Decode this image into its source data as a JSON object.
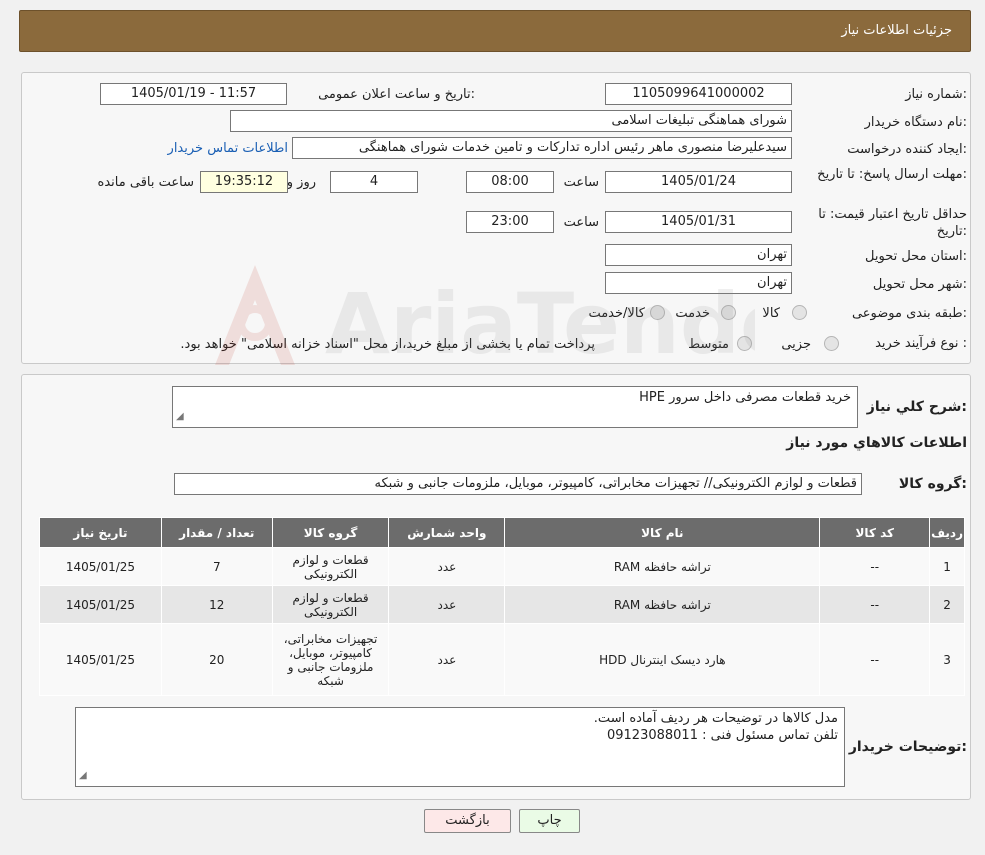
{
  "header": {
    "title": "جزئیات اطلاعات نیاز"
  },
  "form": {
    "need_number_label": "شماره نیاز:",
    "need_number": "1105099641000002",
    "announce_label": "تاریخ و ساعت اعلان عمومی:",
    "announce_value": "1405/01/19 - 11:57",
    "buyer_org_label": "نام دستگاه خریدار:",
    "buyer_org": "شورای هماهنگی تبلیغات اسلامی",
    "creator_label": "ایجاد کننده درخواست:",
    "creator": "سیدعلیرضا منصوری ماهر رئیس اداره تدارکات و تامین خدمات  شورای هماهنگی",
    "contact_link": "اطلاعات تماس خریدار",
    "reply_deadline_label": "مهلت ارسال پاسخ: تا تاریخ:",
    "reply_date": "1405/01/24",
    "time_label": "ساعت",
    "reply_time": "08:00",
    "days_value": "4",
    "days_label": "روز و",
    "remaining_time": "19:35:12",
    "remaining_label": "ساعت باقی مانده",
    "price_validity_label": "حداقل تاریخ اعتبار قیمت: تا تاریخ:",
    "validity_date": "1405/01/31",
    "validity_time": "23:00",
    "province_label": "استان محل تحویل:",
    "province": "تهران",
    "city_label": "شهر محل تحویل:",
    "city": "تهران",
    "category_label": "طبقه بندی موضوعی:",
    "category_options": [
      "کالا",
      "خدمت",
      "کالا/خدمت"
    ],
    "process_label": "نوع فرآیند خرید :",
    "process_options": [
      "جزیی",
      "متوسط"
    ],
    "process_note": "پرداخت تمام یا بخشی از مبلغ خرید،از محل \"اسناد خزانه اسلامی\" خواهد بود."
  },
  "details": {
    "summary_label": "شرح کلي نياز:",
    "summary": "خرید قطعات مصرفی داخل سرور HPE",
    "items_title": "اطلاعات کالاهاي مورد نياز",
    "group_label": "گروه کالا:",
    "group": "قطعات و لوازم الکترونیکی// تجهیزات مخابراتی، کامپیوتر، موبایل، ملزومات جانبی و شبکه",
    "table": {
      "headers": [
        "ردیف",
        "کد کالا",
        "نام کالا",
        "واحد شمارش",
        "گروه کالا",
        "تعداد / مقدار",
        "تاریخ نیاز"
      ],
      "rows": [
        [
          "1",
          "--",
          "تراشه حافظه RAM",
          "عدد",
          "قطعات و لوازم الکترونیکی",
          "7",
          "1405/01/25"
        ],
        [
          "2",
          "--",
          "تراشه حافظه RAM",
          "عدد",
          "قطعات و لوازم الکترونیکی",
          "12",
          "1405/01/25"
        ],
        [
          "3",
          "--",
          "هارد دیسک اینترنال HDD",
          "عدد",
          "تجهیزات مخابراتی، کامپیوتر، موبایل، ملزومات جانبی و شبکه",
          "20",
          "1405/01/25"
        ]
      ]
    },
    "buyer_notes_label": "توضیحات خریدار:",
    "buyer_notes_line1": "مدل کالاها در توضیحات هر ردیف آماده است.",
    "buyer_notes_line2": "تلفن تماس مسئول فنی : 09123088011"
  },
  "buttons": {
    "print": "چاپ",
    "back": "بازگشت"
  },
  "watermark_text": "AriaTender.neT",
  "colors": {
    "header_bg": "#8b6a3c",
    "table_header_bg": "#6c6c6c",
    "link": "#1a5fb4",
    "back_button_bg": "#fde8e8",
    "print_button_bg": "#eafbe6"
  }
}
